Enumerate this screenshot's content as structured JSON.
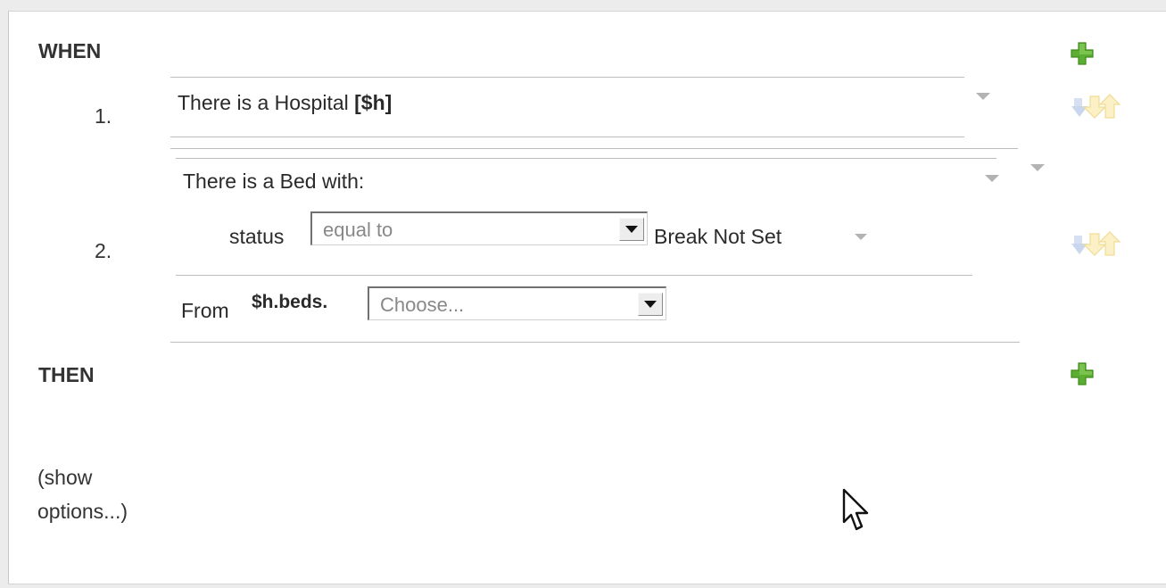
{
  "when": {
    "label": "WHEN",
    "rows": [
      {
        "number": "1.",
        "text": "There is a Hospital",
        "binding": "[$h]"
      },
      {
        "number": "2.",
        "header": "There is a Bed with:",
        "field": "status",
        "operator": "equal to",
        "value": "Break Not Set",
        "from_label": "From",
        "from_expr": "$h.beds.",
        "from_select": "Choose..."
      }
    ]
  },
  "then": {
    "label": "THEN"
  },
  "options_link": "(show options...)",
  "icons": {
    "add": "add-icon",
    "move": "move-arrows-icon",
    "dropdown": "chevron-down-icon",
    "cursor": "mouse-cursor-icon"
  },
  "colors": {
    "plus_green": "#5cae32",
    "text": "#2a2a2a",
    "divider": "#bdbdbd",
    "arrow_blue": "#c9d7ee",
    "arrow_yellow": "#f2e2a6"
  }
}
